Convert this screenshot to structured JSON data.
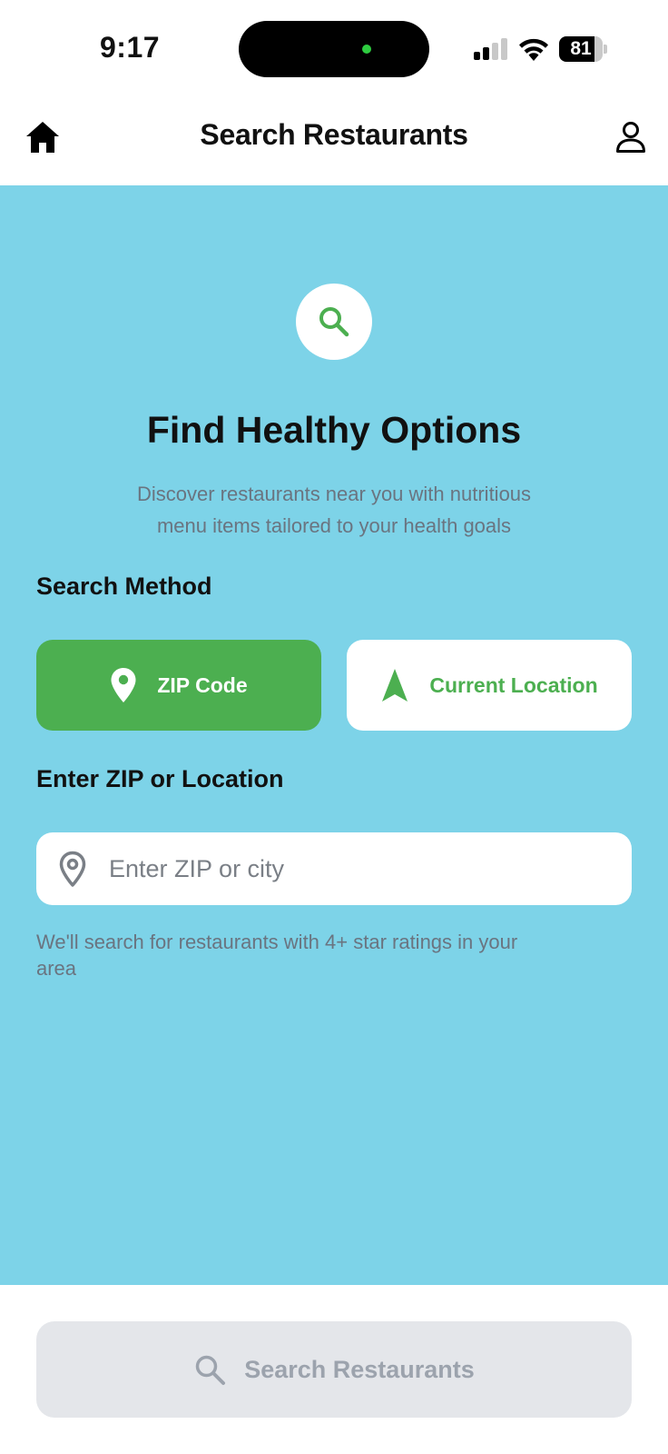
{
  "status_bar": {
    "time": "9:17",
    "battery": "81",
    "battery_level_percent": 81
  },
  "header": {
    "title": "Search Restaurants",
    "left_icon": "home-icon",
    "right_icon": "person-icon"
  },
  "hero": {
    "icon": "search-icon",
    "title": "Find Healthy Options",
    "subtitle_line1": "Discover restaurants near you with nutritious",
    "subtitle_line2": "menu items tailored to your health goals"
  },
  "search_method": {
    "label": "Search Method",
    "options": [
      {
        "label": "ZIP Code",
        "icon": "map-pin-icon",
        "selected": true
      },
      {
        "label": "Current Location",
        "icon": "navigation-arrow-icon",
        "selected": false
      }
    ]
  },
  "location": {
    "label": "Enter ZIP or Location",
    "placeholder": "Enter ZIP or city",
    "value": "",
    "icon": "map-pin-outline-icon",
    "helper_line1": "We'll search for restaurants with 4+ star ratings in your",
    "helper_line2": "area"
  },
  "footer": {
    "search_button_label": "Search Restaurants",
    "search_button_icon": "search-icon",
    "search_button_enabled": false
  },
  "colors": {
    "background": "#7dd3e8",
    "accent": "#4caf50",
    "muted_text": "#6a7480",
    "disabled_button": "#e4e6ea"
  }
}
